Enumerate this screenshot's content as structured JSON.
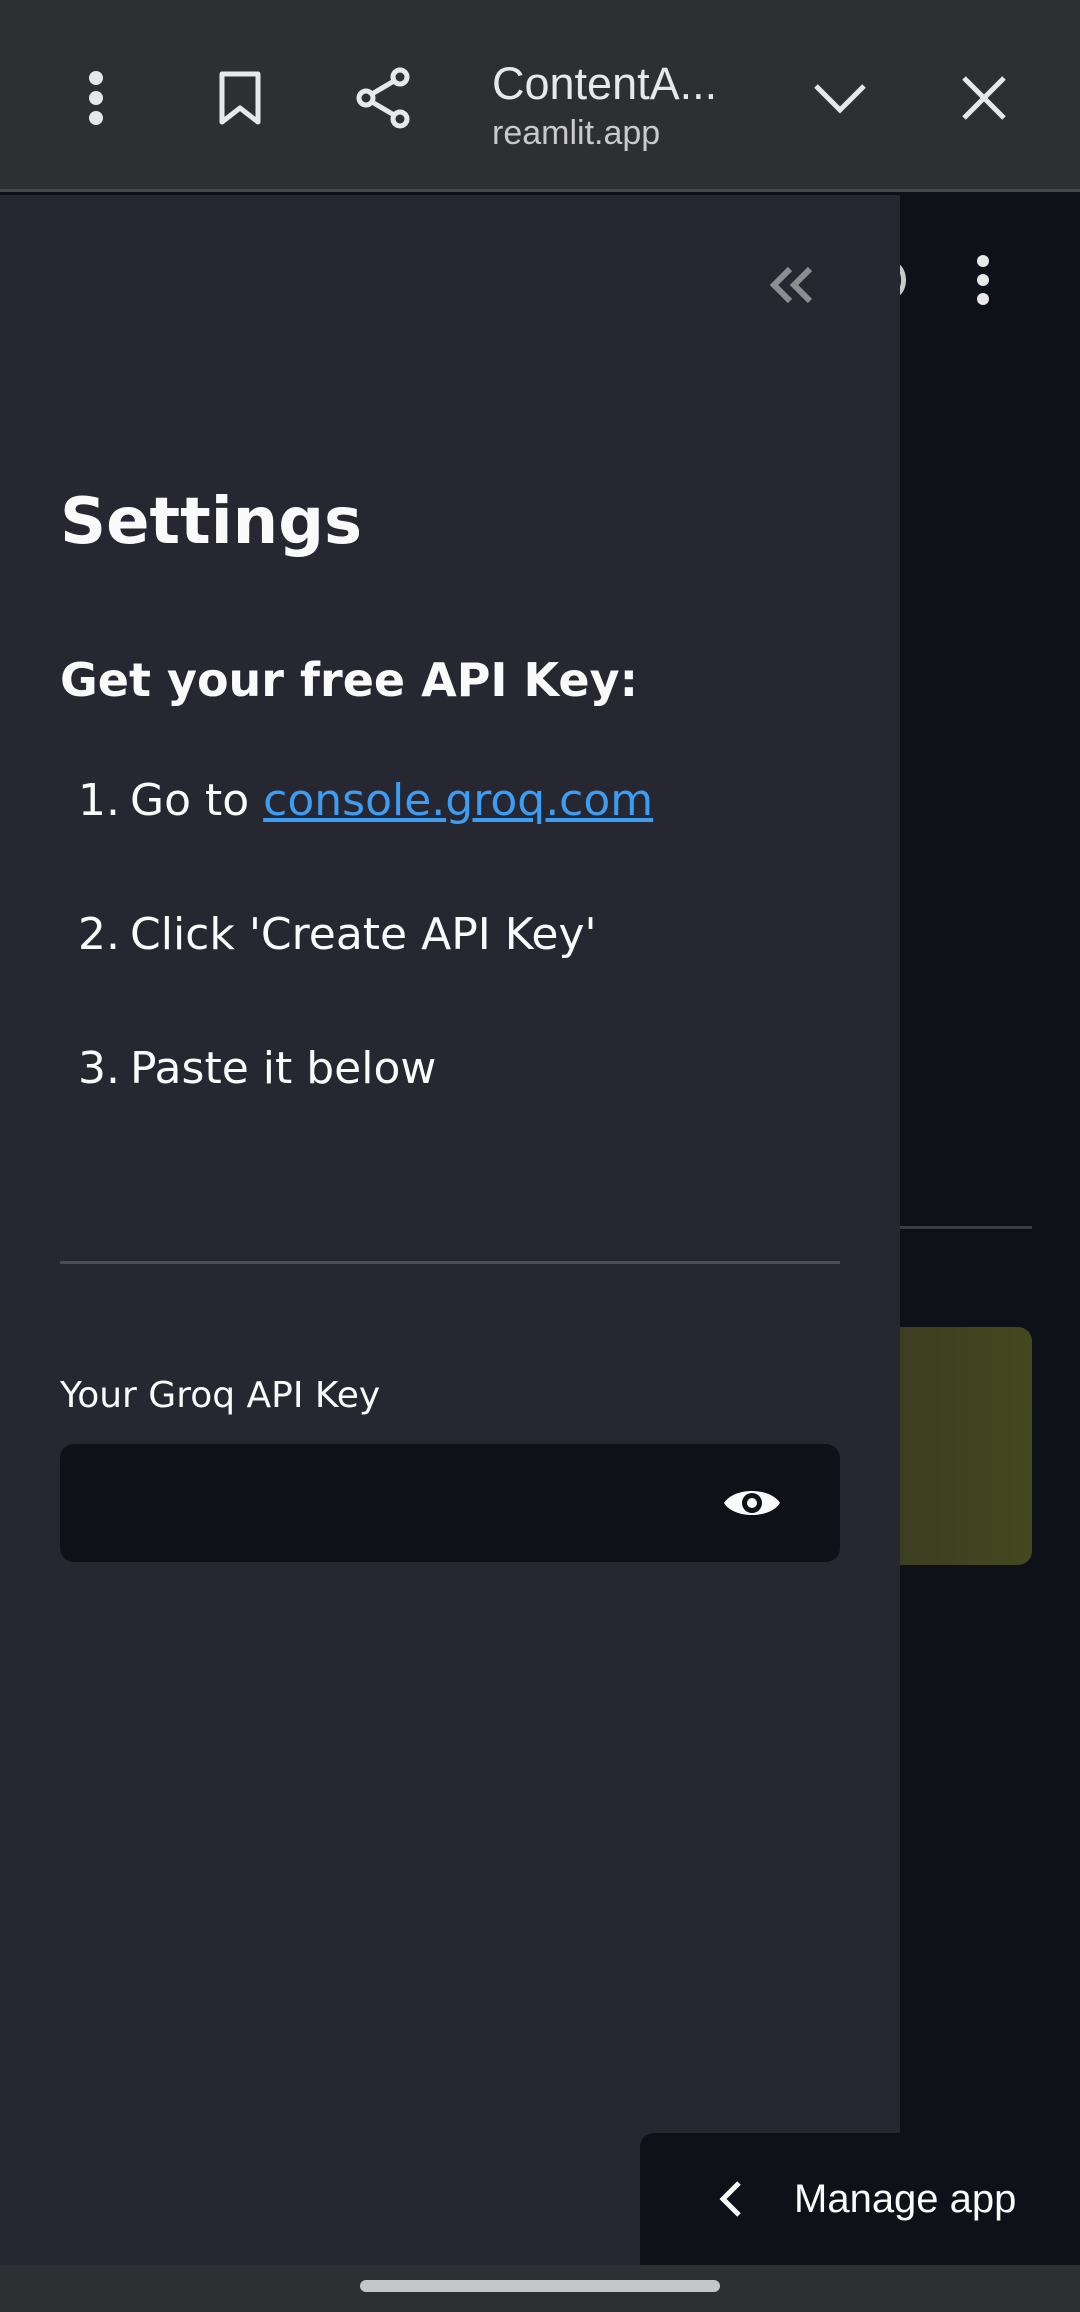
{
  "browser": {
    "title": "ContentA...",
    "url": "reamlit.app",
    "icons": [
      "more-vert-icon",
      "bookmark-icon",
      "share-icon",
      "chevron-down-icon",
      "close-icon"
    ]
  },
  "sidebar": {
    "title": "Settings",
    "subtitle": "Get your free API Key:",
    "steps": [
      {
        "num": "1.",
        "prefix": "Go to ",
        "link": "console.groq.com"
      },
      {
        "num": "2.",
        "text": "Click 'Create API Key'"
      },
      {
        "num": "3.",
        "text": "Paste it below"
      }
    ],
    "api_key_label": "Your Groq API Key",
    "api_key_value": ""
  },
  "manage_app": {
    "label": "Manage app"
  },
  "colors": {
    "sidebar_bg": "#262730",
    "main_bg": "#0e1117",
    "link": "#3d9df3",
    "topbar_bg": "#2e2f33"
  }
}
